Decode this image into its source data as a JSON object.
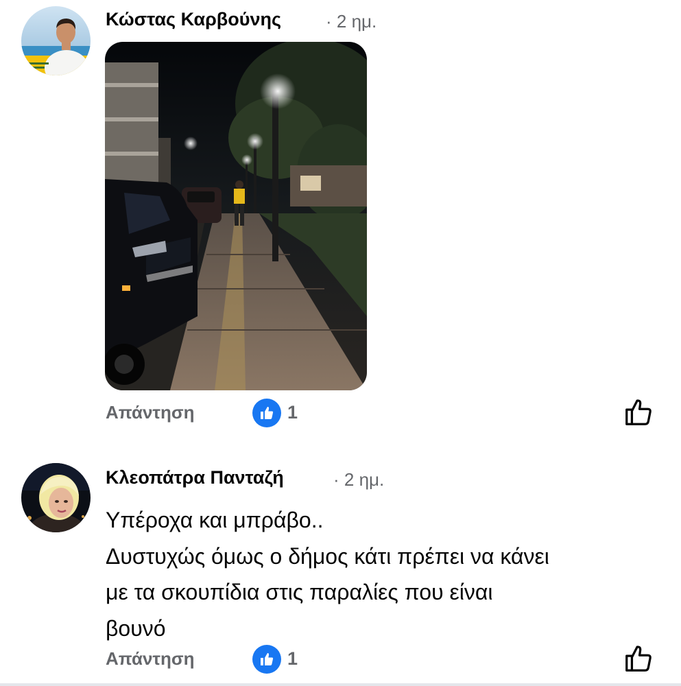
{
  "comments": [
    {
      "author": "Κώστας Καρβούνης",
      "separator": "·",
      "time": "2 ημ.",
      "attachment": "photo",
      "reply_label": "Απάντηση",
      "reaction_icon": "like-icon",
      "reaction_count": "1",
      "like_button_icon": "thumbs-up-outline-icon"
    },
    {
      "author": "Κλεοπάτρα Πανταζή",
      "separator": "·",
      "time": "2 ημ.",
      "text_lines": [
        "Υπέροχα και μπράβο..",
        "Δυστυχώς όμως ο δήμος κάτι πρέπει να κάνει",
        "με τα σκουπίδια στις παραλίες που είναι",
        "βουνό"
      ],
      "reply_label": "Απάντηση",
      "reaction_icon": "like-icon",
      "reaction_count": "1",
      "like_button_icon": "thumbs-up-outline-icon"
    }
  ],
  "colors": {
    "text_primary": "#050505",
    "text_secondary": "#65676b",
    "like_blue": "#1877f2"
  }
}
